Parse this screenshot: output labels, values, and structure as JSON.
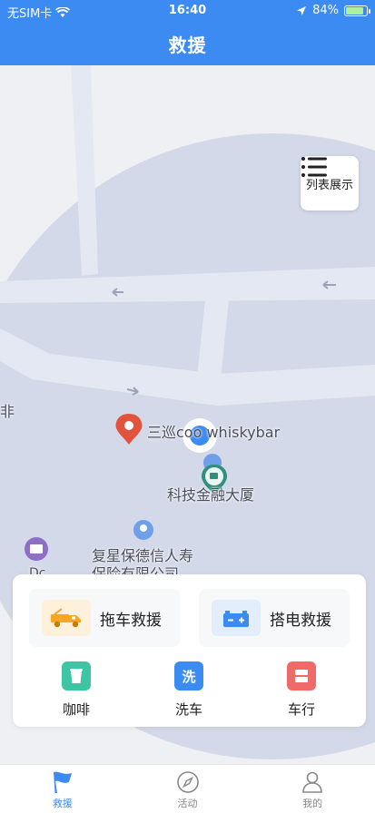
{
  "status_bar": {
    "carrier": "无SIM卡",
    "time": "16:40",
    "battery": "84%"
  },
  "header": {
    "title": "救援"
  },
  "map": {
    "list_button_label": "列表展示",
    "poi_whisky": "三巡coo  whiskybar",
    "poi_tower": "科技金融大厦",
    "poi_insurance_line1": "复星保德信人寿",
    "poi_insurance_line2": "保险有限公司",
    "edge_label_left": "非",
    "edge_label_bottom": "Dc"
  },
  "rescue": {
    "tow": {
      "label": "拖车救援",
      "icon": "tow-truck-icon",
      "color": "#f6a623"
    },
    "jump": {
      "label": "搭电救援",
      "icon": "car-battery-icon",
      "color": "#3b8bf2"
    }
  },
  "services": [
    {
      "label": "咖啡",
      "icon": "cup-icon",
      "color": "#3ec6a4"
    },
    {
      "label": "洗车",
      "icon_text": "洗",
      "color": "#3b8bf2"
    },
    {
      "label": "车行",
      "icon": "store-icon",
      "color": "#f06a6a"
    }
  ],
  "tabs": [
    {
      "label": "救援",
      "icon": "flag-icon",
      "active": true
    },
    {
      "label": "活动",
      "icon": "compass-icon",
      "active": false
    },
    {
      "label": "我的",
      "icon": "user-icon",
      "active": false
    }
  ],
  "colors": {
    "primary": "#3b8bf2"
  }
}
